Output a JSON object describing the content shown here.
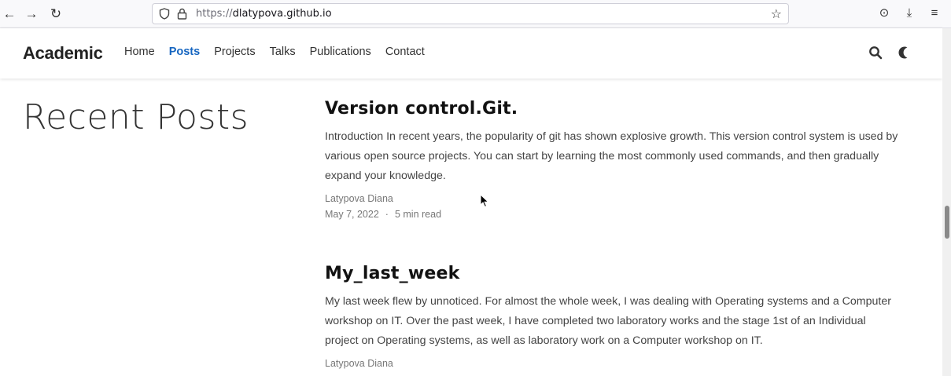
{
  "browser": {
    "url_protocol": "https://",
    "url_host": "dlatypova.github.io",
    "back_glyph": "←",
    "forward_glyph": "→",
    "reload_glyph": "↻",
    "star_glyph": "☆",
    "pocket_glyph": "⊙",
    "download_glyph": "⤓",
    "menu_glyph": "≡"
  },
  "site": {
    "brand": "Academic",
    "menu": [
      {
        "label": "Home",
        "active": false
      },
      {
        "label": "Posts",
        "active": true
      },
      {
        "label": "Projects",
        "active": false
      },
      {
        "label": "Talks",
        "active": false
      },
      {
        "label": "Publications",
        "active": false
      },
      {
        "label": "Contact",
        "active": false
      }
    ],
    "accent_color": "#1565c0"
  },
  "page": {
    "title": "Recent Posts"
  },
  "posts": [
    {
      "title": "Version control.Git.",
      "summary": "Introduction In recent years, the popularity of git has shown explosive growth. This version control system is used by various open source projects. You can start by learning the most commonly used commands, and then gradually expand your knowledge.",
      "author": "Latypova Diana",
      "date": "May 7, 2022",
      "separator": "·",
      "read_time": "5 min read"
    },
    {
      "title": "My_last_week",
      "summary": "My last week flew by unnoticed. For almost the whole week, I was dealing with Operating systems and a Computer workshop on IT. Over the past week, I have completed two laboratory works and the stage 1st of an Individual project on Operating systems, as well as laboratory work on a Computer workshop on IT.",
      "author": "Latypova Diana"
    }
  ]
}
